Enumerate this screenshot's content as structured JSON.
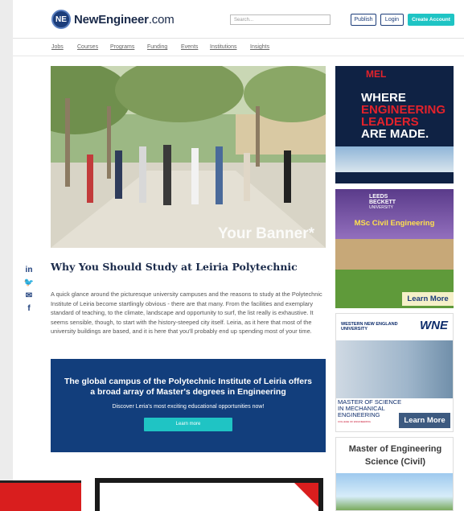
{
  "header": {
    "logo_badge": "NE",
    "logo_brand": "NewEngineer",
    "logo_suffix": ".com",
    "search_placeholder": "Search...",
    "publish": "Publish",
    "login": "Login",
    "create_account": "Create Account"
  },
  "nav": {
    "items": [
      "Jobs",
      "Courses",
      "Programs",
      "Funding",
      "Events",
      "Institutions",
      "Insights"
    ]
  },
  "banner": {
    "overlay_text": "Your Banner*"
  },
  "social": {
    "icons": [
      "linkedin-icon",
      "twitter-icon",
      "email-icon",
      "facebook-icon"
    ],
    "glyphs": [
      "in",
      "🐦",
      "✉",
      "f"
    ]
  },
  "article": {
    "title": "Why You Should Study at Leiria Polytechnic",
    "body": "A quick glance around the picturesque university campuses and the reasons to study at the Polytechnic Institute of Leiria become startlingly obvious - there are that many. From the facilities and exemplary standard of teaching, to the climate, landscape and opportunity to surf, the list really is exhaustive. It seems sensible, though, to start with the history-steeped city itself. Leiria, as it here that most of the university buildings are based, and it is here that you'll probably end up spending most of your time."
  },
  "cta": {
    "heading": "The global campus of the Polytechnic Institute of Leiria offers a broad array of Master's degrees in Engineering",
    "sub": "Discover Leria's most exciting educational opportunities now!",
    "button": "Learn more"
  },
  "ads": {
    "ad1": {
      "org": "MEL",
      "line1": "WHERE",
      "line2": "ENGINEERING",
      "line3": "LEADERS",
      "line4": "ARE MADE."
    },
    "ad2": {
      "logo_line1": "LEEDS",
      "logo_line2": "BECKETT",
      "logo_line3": "UNIVERSITY",
      "title": "MSc Civil Engineering",
      "button": "Learn More"
    },
    "ad3": {
      "logo": "WESTERN NEW ENGLAND",
      "logo_sub": "UNIVERSITY",
      "mark": "WNE",
      "text": "MASTER OF SCIENCE IN MECHANICAL ENGINEERING",
      "sub": "COLLEGE OF ENGINEERING",
      "button": "Learn More"
    },
    "ad4": {
      "title": "Master of Engineering Science (Civil)"
    }
  },
  "colors": {
    "brand_navy": "#1c3d7a",
    "accent_teal": "#1fc4c4",
    "cta_blue": "#123e7c"
  }
}
